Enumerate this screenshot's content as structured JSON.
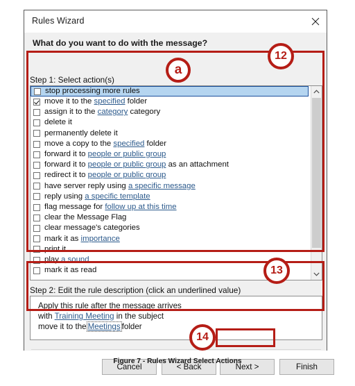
{
  "dialog": {
    "title": "Rules Wizard",
    "close_icon": "close-icon",
    "prompt": "What do you want to do with the message?"
  },
  "step1": {
    "label": "Step 1: Select action(s)",
    "actions": [
      {
        "text_before": "stop processing more rules",
        "link": "",
        "text_after": "",
        "checked": false,
        "selected": true
      },
      {
        "text_before": "move it to the ",
        "link": "specified",
        "text_after": " folder",
        "checked": true,
        "selected": false
      },
      {
        "text_before": "assign it to the ",
        "link": "category",
        "text_after": " category",
        "checked": false,
        "selected": false
      },
      {
        "text_before": "delete it",
        "link": "",
        "text_after": "",
        "checked": false,
        "selected": false
      },
      {
        "text_before": "permanently delete it",
        "link": "",
        "text_after": "",
        "checked": false,
        "selected": false
      },
      {
        "text_before": "move a copy to the ",
        "link": "specified",
        "text_after": " folder",
        "checked": false,
        "selected": false
      },
      {
        "text_before": "forward it to ",
        "link": "people or public group",
        "text_after": "",
        "checked": false,
        "selected": false
      },
      {
        "text_before": "forward it to ",
        "link": "people or public group",
        "text_after": " as an attachment",
        "checked": false,
        "selected": false
      },
      {
        "text_before": "redirect it to ",
        "link": "people or public group",
        "text_after": "",
        "checked": false,
        "selected": false
      },
      {
        "text_before": "have server reply using ",
        "link": "a specific message",
        "text_after": "",
        "checked": false,
        "selected": false
      },
      {
        "text_before": "reply using ",
        "link": "a specific template",
        "text_after": "",
        "checked": false,
        "selected": false
      },
      {
        "text_before": "flag message for ",
        "link": "follow up at this time",
        "text_after": "",
        "checked": false,
        "selected": false
      },
      {
        "text_before": "clear the Message Flag",
        "link": "",
        "text_after": "",
        "checked": false,
        "selected": false
      },
      {
        "text_before": "clear message's categories",
        "link": "",
        "text_after": "",
        "checked": false,
        "selected": false
      },
      {
        "text_before": "mark it as ",
        "link": "importance",
        "text_after": "",
        "checked": false,
        "selected": false
      },
      {
        "text_before": "print it",
        "link": "",
        "text_after": "",
        "checked": false,
        "selected": false
      },
      {
        "text_before": "play ",
        "link": "a sound",
        "text_after": "",
        "checked": false,
        "selected": false
      },
      {
        "text_before": "mark it as read",
        "link": "",
        "text_after": "",
        "checked": false,
        "selected": false
      }
    ],
    "scrollbar": {
      "up_icon": "chevron-up-icon",
      "down_icon": "chevron-down-icon"
    }
  },
  "step2": {
    "label": "Step 2: Edit the rule description (click an underlined value)",
    "line1": "Apply this rule after the message arrives",
    "line2_before": "with ",
    "line2_link": "Training Meeting",
    "line2_after": " in the subject",
    "line3_before": "move it to the",
    "line3_link": "Meetings",
    "line3_after": "folder"
  },
  "footer": {
    "cancel": "Cancel",
    "back": "< Back",
    "next": "Next >",
    "finish": "Finish"
  },
  "annotations": {
    "marker_12": "12",
    "marker_a": "a",
    "marker_13": "13",
    "marker_14": "14",
    "accent_color": "#b51d16"
  },
  "caption": "Figure 7 - Rules Wizard Select Actions"
}
